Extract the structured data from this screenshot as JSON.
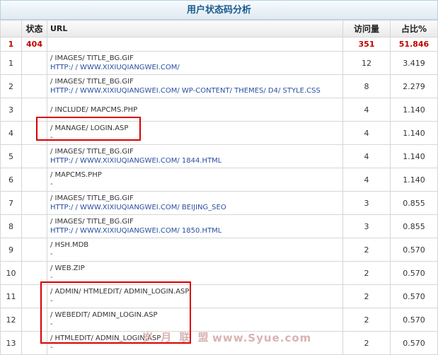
{
  "report": {
    "title": "用户状态码分析",
    "headers": {
      "status": "状态",
      "url": "URL",
      "visits": "访问量",
      "percent": "占比%"
    },
    "summary": {
      "index": "1",
      "status": "404",
      "visits": "351",
      "percent": "51.846"
    },
    "rows": [
      {
        "index": "1",
        "path": "/ IMAGES/ TITLE_BG.GIF",
        "referrer": "HTTP:/ / WWW.XIXIUQIANGWEI.COM/",
        "visits": "12",
        "percent": "3.419"
      },
      {
        "index": "2",
        "path": "/ IMAGES/ TITLE_BG.GIF",
        "referrer": "HTTP:/ / WWW.XIXIUQIANGWEI.COM/ WP-CONTENT/ THEMES/ D4/ STYLE.CSS",
        "visits": "8",
        "percent": "2.279"
      },
      {
        "index": "3",
        "path": "/ INCLUDE/ MAPCMS.PHP",
        "referrer": "",
        "visits": "4",
        "percent": "1.140"
      },
      {
        "index": "4",
        "path": "/ MANAGE/ LOGIN.ASP",
        "referrer": "-",
        "visits": "4",
        "percent": "1.140"
      },
      {
        "index": "5",
        "path": "/ IMAGES/ TITLE_BG.GIF",
        "referrer": "HTTP:/ / WWW.XIXIUQIANGWEI.COM/ 1844.HTML",
        "visits": "4",
        "percent": "1.140"
      },
      {
        "index": "6",
        "path": "/ MAPCMS.PHP",
        "referrer": "-",
        "visits": "4",
        "percent": "1.140"
      },
      {
        "index": "7",
        "path": "/ IMAGES/ TITLE_BG.GIF",
        "referrer": "HTTP:/ / WWW.XIXIUQIANGWEI.COM/ BEIJING_SEO",
        "visits": "3",
        "percent": "0.855"
      },
      {
        "index": "8",
        "path": "/ IMAGES/ TITLE_BG.GIF",
        "referrer": "HTTP:/ / WWW.XIXIUQIANGWEI.COM/ 1850.HTML",
        "visits": "3",
        "percent": "0.855"
      },
      {
        "index": "9",
        "path": "/ HSH.MDB",
        "referrer": "-",
        "visits": "2",
        "percent": "0.570"
      },
      {
        "index": "10",
        "path": "/ WEB.ZIP",
        "referrer": "-",
        "visits": "2",
        "percent": "0.570"
      },
      {
        "index": "11",
        "path": "/ ADMIN/ HTMLEDIT/ ADMIN_LOGIN.ASP",
        "referrer": "-",
        "visits": "2",
        "percent": "0.570"
      },
      {
        "index": "12",
        "path": "/ WEBEDIT/ ADMIN_LOGIN.ASP",
        "referrer": "-",
        "visits": "2",
        "percent": "0.570"
      },
      {
        "index": "13",
        "path": "/ HTMLEDIT/ ADMIN_LOGIN.ASP",
        "referrer": "-",
        "visits": "2",
        "percent": "0.570"
      }
    ]
  },
  "watermark": {
    "text": "岁 月 联 盟",
    "url": "www.Syue.com"
  },
  "colors": {
    "highlight": "#d80000",
    "summary": "#c40000",
    "link": "#2a4fa0",
    "title": "#1a5a8a"
  }
}
